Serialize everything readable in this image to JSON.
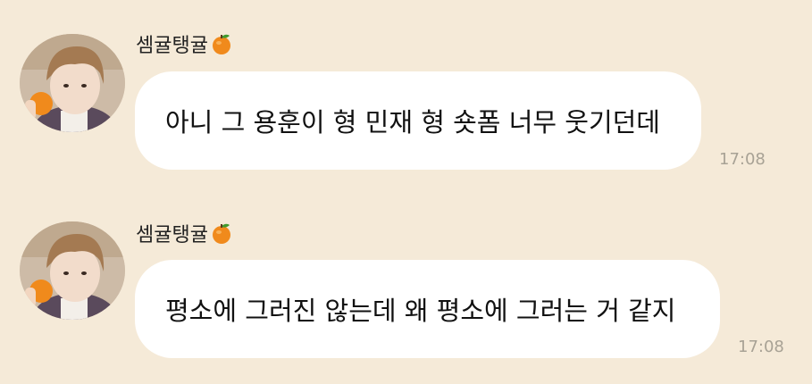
{
  "messages": [
    {
      "sender": "셈귤탱귤",
      "sender_emoji": "tangerine-emoji",
      "text": "아니 그 용훈이 형 민재 형 숏폼 너무 웃기던데",
      "time": "17:08"
    },
    {
      "sender": "셈귤탱귤",
      "sender_emoji": "tangerine-emoji",
      "text": "평소에 그러진 않는데 왜 평소에 그러는 거 같지",
      "time": "17:08"
    }
  ],
  "colors": {
    "background": "#f5ead8",
    "bubble": "#ffffff",
    "timestamp": "#a8a295",
    "tangerine": "#f08a1c"
  }
}
